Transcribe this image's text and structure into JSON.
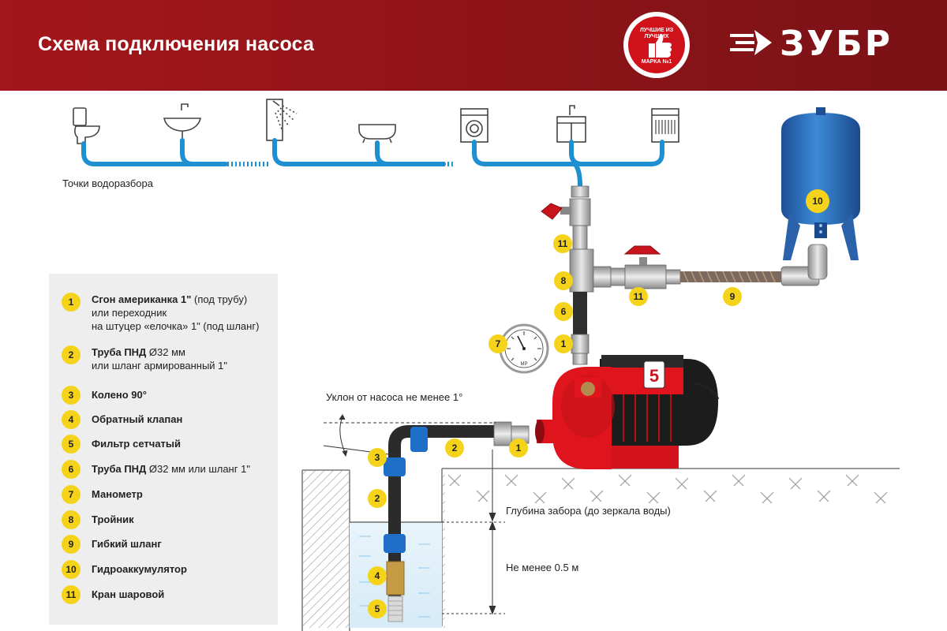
{
  "header": {
    "title": "Схема подключения насоса",
    "badge_top": "ЛУЧШИЕ ИЗ ЛУЧШИХ",
    "badge_bottom": "МАРКА №1",
    "brand": "ЗУБР"
  },
  "captions": {
    "points": "Точки водоразбора",
    "slope": "Уклон от насоса не менее 1°",
    "depth": "Глубина забора (до зеркала воды)",
    "min_depth": "Не менее 0.5 м"
  },
  "fixture_icons": [
    "toilet-icon",
    "sink-icon",
    "shower-icon",
    "bathtub-icon",
    "washing-machine-icon",
    "kitchen-sink-icon",
    "dishwasher-icon"
  ],
  "legend": [
    {
      "num": "1",
      "bold": "Сгон американка 1\"",
      "rest": " (под трубу)",
      "line2": "или переходник",
      "line3": "на штуцер «елочка» 1\" (под шланг)"
    },
    {
      "num": "2",
      "bold": "Труба ПНД",
      "rest": " Ø32 мм",
      "line2": "или шланг армированный 1\"",
      "line3": ""
    },
    {
      "num": "3",
      "bold": "Колено 90°",
      "rest": "",
      "line2": "",
      "line3": ""
    },
    {
      "num": "4",
      "bold": "Обратный клапан",
      "rest": "",
      "line2": "",
      "line3": ""
    },
    {
      "num": "5",
      "bold": "Фильтр сетчатый",
      "rest": "",
      "line2": "",
      "line3": ""
    },
    {
      "num": "6",
      "bold": "Труба ПНД",
      "rest": " Ø32 мм или шланг 1\"",
      "line2": "",
      "line3": ""
    },
    {
      "num": "7",
      "bold": "Манометр",
      "rest": "",
      "line2": "",
      "line3": ""
    },
    {
      "num": "8",
      "bold": "Тройник",
      "rest": "",
      "line2": "",
      "line3": ""
    },
    {
      "num": "9",
      "bold": "Гибкий шланг",
      "rest": "",
      "line2": "",
      "line3": ""
    },
    {
      "num": "10",
      "bold": "Гидроаккумулятор",
      "rest": "",
      "line2": "",
      "line3": ""
    },
    {
      "num": "11",
      "bold": "Кран шаровой",
      "rest": "",
      "line2": "",
      "line3": ""
    }
  ],
  "callouts": [
    "11",
    "8",
    "6",
    "1",
    "7",
    "11",
    "9",
    "10",
    "3",
    "2",
    "1",
    "2",
    "4",
    "5"
  ],
  "gauge_unit": "MP",
  "pump_label": "5",
  "colors": {
    "brand_red": "#a3161b",
    "pipe_blue": "#1e8fd0",
    "marker_yellow": "#f5d31b",
    "pump_red": "#e0141c",
    "tank_blue": "#2b6fb8"
  }
}
